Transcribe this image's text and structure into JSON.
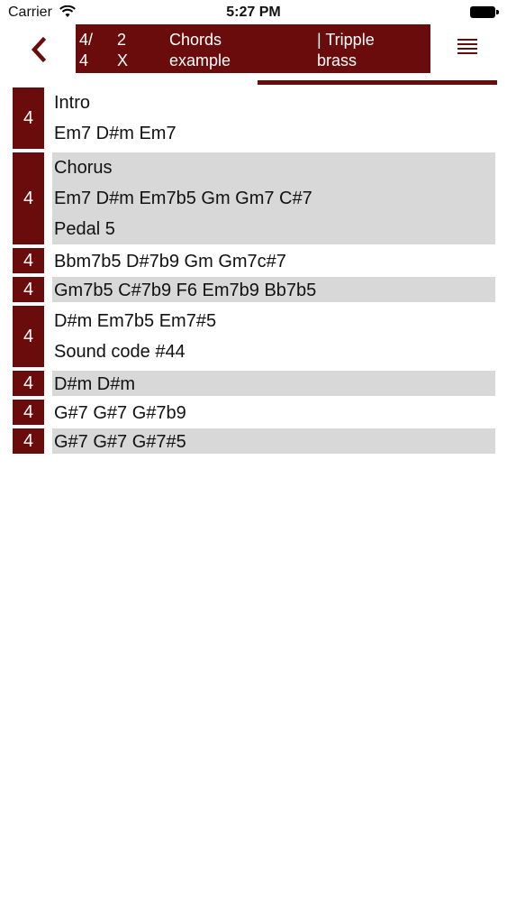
{
  "status": {
    "carrier": "Carrier",
    "time": "5:27 PM"
  },
  "header": {
    "time_sig": [
      "4/",
      "4"
    ],
    "repeat": [
      "2",
      "X"
    ],
    "title": [
      "Chords",
      "example"
    ],
    "style": [
      "| Tripple",
      "brass"
    ]
  },
  "rows": [
    {
      "beats": "4",
      "shaded": false,
      "lines": [
        "Intro",
        "Em7 D#m Em7"
      ]
    },
    {
      "beats": "4",
      "shaded": true,
      "lines": [
        "Chorus",
        "Em7 D#m Em7b5 Gm Gm7 C#7",
        "Pedal 5"
      ]
    },
    {
      "beats": "4",
      "shaded": false,
      "lines": [
        "Bbm7b5 D#7b9 Gm Gm7c#7"
      ]
    },
    {
      "beats": "4",
      "shaded": true,
      "lines": [
        "Gm7b5 C#7b9 F6 Em7b9 Bb7b5"
      ]
    },
    {
      "beats": "4",
      "shaded": false,
      "lines": [
        "D#m Em7b5 Em7#5",
        "Sound code #44"
      ]
    },
    {
      "beats": "4",
      "shaded": true,
      "lines": [
        "D#m D#m"
      ]
    },
    {
      "beats": "4",
      "shaded": false,
      "lines": [
        "G#7 G#7 G#7b9"
      ]
    },
    {
      "beats": "4",
      "shaded": true,
      "lines": [
        "G#7 G#7 G#7#5"
      ]
    }
  ],
  "icons": {
    "back": "chevron-left-icon",
    "menu": "list-menu-icon",
    "wifi": "wifi-icon",
    "battery": "battery-icon"
  },
  "colors": {
    "accent": "#6b0c0c",
    "row_shade": "#d8d8d8"
  }
}
